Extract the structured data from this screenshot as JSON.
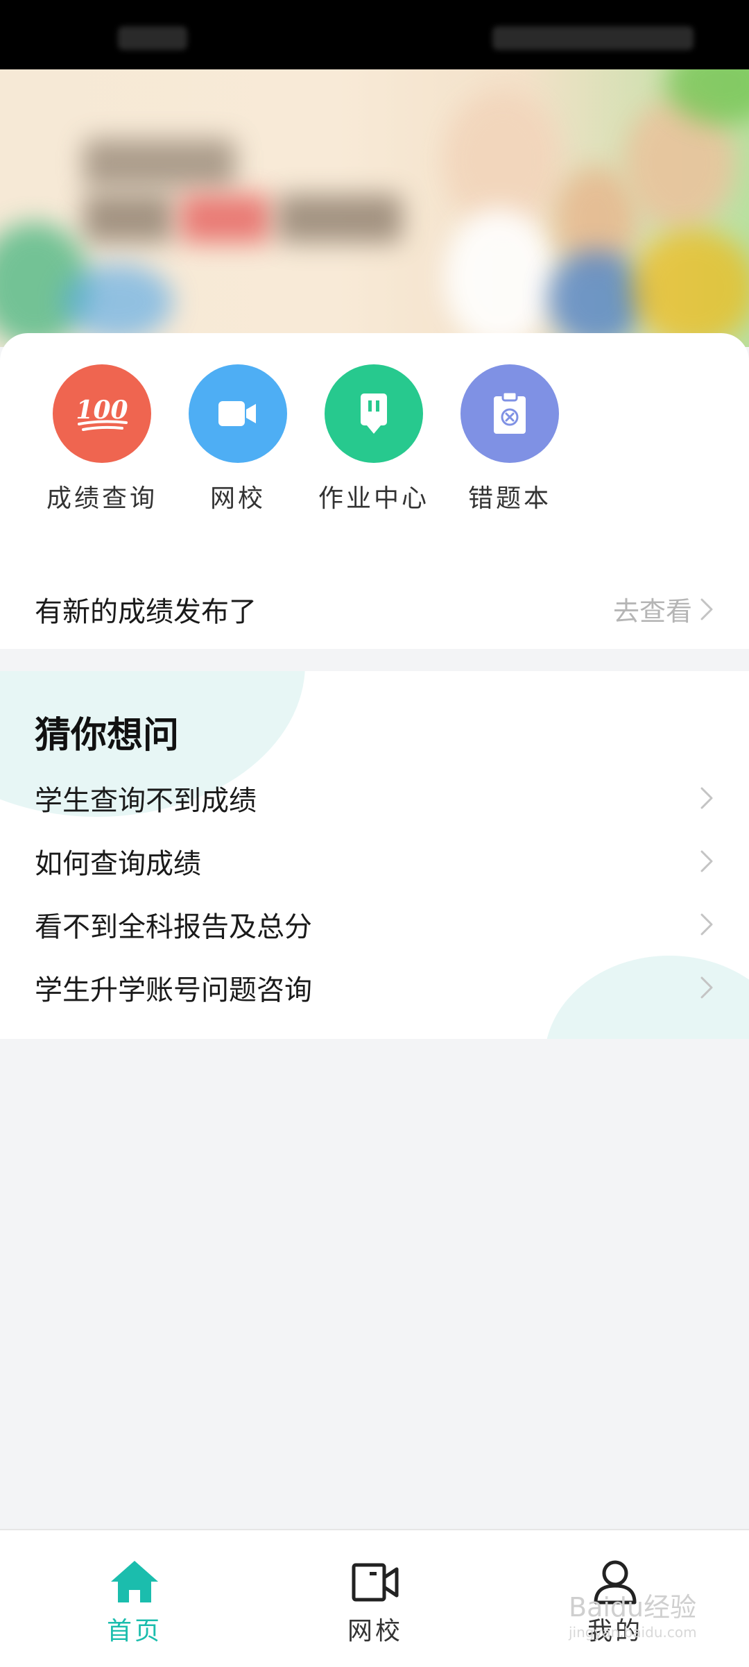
{
  "quick_actions": [
    {
      "label": "成绩查询",
      "icon": "score-100-icon",
      "color": "#ef6550"
    },
    {
      "label": "网校",
      "icon": "video-camera-icon",
      "color": "#4eaef4"
    },
    {
      "label": "作业中心",
      "icon": "homework-icon",
      "color": "#27c98e"
    },
    {
      "label": "错题本",
      "icon": "clipboard-x-icon",
      "color": "#7f91e4"
    }
  ],
  "score_100_text": "100",
  "notice": {
    "text": "有新的成绩发布了",
    "link_label": "去查看"
  },
  "faq": {
    "title": "猜你想问",
    "items": [
      "学生查询不到成绩",
      "如何查询成绩",
      "看不到全科报告及总分",
      "学生升学账号问题咨询"
    ]
  },
  "bottom_nav": {
    "active_color": "#1bbdad",
    "items": [
      {
        "label": "首页",
        "icon": "home-icon",
        "active": true
      },
      {
        "label": "网校",
        "icon": "video-camera-icon",
        "active": false
      },
      {
        "label": "我的",
        "icon": "user-icon",
        "active": false
      }
    ]
  },
  "watermark": {
    "brand": "Baidu经验",
    "url": "jingyan.baidu.com"
  }
}
